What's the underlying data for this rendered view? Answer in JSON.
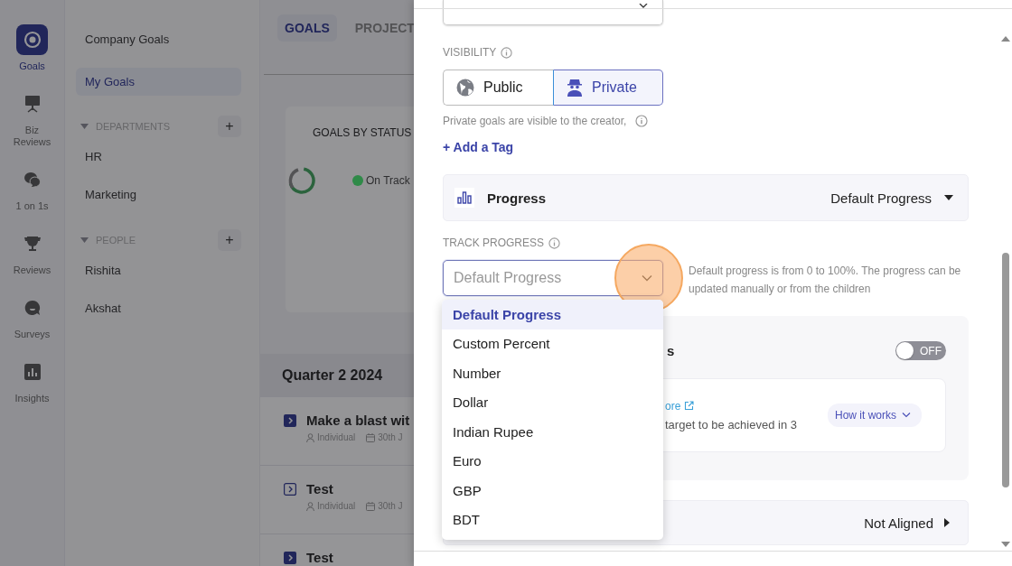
{
  "rail": [
    {
      "label": "Goals",
      "kind": "target",
      "selected": true
    },
    {
      "label": "Biz\nReviews",
      "kind": "board",
      "selected": false
    },
    {
      "label": "1 on 1s",
      "kind": "chats",
      "selected": false
    },
    {
      "label": "Reviews",
      "kind": "trophy",
      "selected": false
    },
    {
      "label": "Surveys",
      "kind": "bubble",
      "selected": false
    },
    {
      "label": "Insights",
      "kind": "chart",
      "selected": false
    }
  ],
  "sidebar": {
    "items": [
      {
        "label": "Company Goals",
        "selected": false
      },
      {
        "label": "My Goals",
        "selected": true
      }
    ],
    "sections": [
      {
        "title": "DEPARTMENTS",
        "add": "+",
        "expanded": true,
        "items": [
          "HR",
          "Marketing"
        ]
      },
      {
        "title": "PEOPLE",
        "add": "+",
        "expanded": true,
        "items": [
          "Rishita",
          "Akshat"
        ]
      }
    ]
  },
  "main": {
    "tabs": [
      {
        "label": "GOALS",
        "selected": true
      },
      {
        "label": "PROJECT",
        "selected": false
      }
    ],
    "status_card": {
      "title": "GOALS BY STATUS",
      "legend": [
        {
          "label": "On Track",
          "color": "#2f8a48"
        }
      ]
    },
    "quarter": "Quarter 2 2024",
    "goals": [
      {
        "title": "Make a blast wit",
        "kind": "filled",
        "owner": "Individual",
        "date": "30th J"
      },
      {
        "title": "Test",
        "kind": "outline",
        "owner": "Individual",
        "date": "30th J"
      },
      {
        "title": "Test",
        "kind": "filled"
      }
    ]
  },
  "drawer": {
    "visibility": {
      "label": "VISIBILITY",
      "options": [
        {
          "label": "Public",
          "kind": "globe",
          "selected": false
        },
        {
          "label": "Private",
          "kind": "spy",
          "selected": true
        }
      ],
      "hint": "Private goals are visible to the creator,"
    },
    "add_tag": "+ Add a Tag",
    "progress_section": {
      "title": "Progress",
      "value": "Default Progress"
    },
    "track_progress": {
      "label": "TRACK PROGRESS",
      "placeholder": "Default Progress",
      "help": "Default progress is from 0 to 100%. The progress can be updated manually or from the children",
      "expanded": true,
      "options": [
        {
          "label": "Default Progress",
          "selected": true
        },
        {
          "label": "Custom Percent",
          "selected": false
        },
        {
          "label": "Number",
          "selected": false
        },
        {
          "label": "Dollar",
          "selected": false
        },
        {
          "label": "Indian Rupee",
          "selected": false
        },
        {
          "label": "Euro",
          "selected": false
        },
        {
          "label": "GBP",
          "selected": false
        },
        {
          "label": "BDT",
          "selected": false
        }
      ]
    },
    "behind_card": {
      "heading": "s",
      "toggle": {
        "label": "OFF",
        "on": false
      },
      "link": "ore",
      "text": "target to be achieved in 3",
      "how_button": "How it works"
    },
    "alignment": {
      "value": "Not Aligned"
    }
  }
}
